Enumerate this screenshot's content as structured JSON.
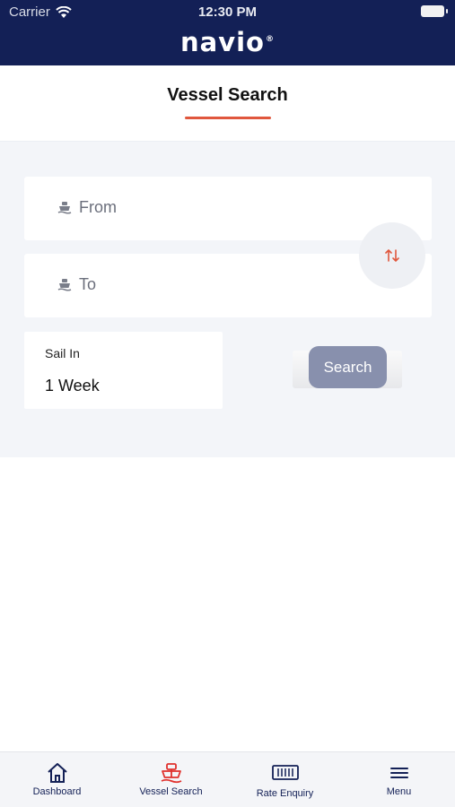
{
  "status_bar": {
    "carrier": "Carrier",
    "time": "12:30 PM"
  },
  "header": {
    "logo": "navio",
    "logo_mark": "®"
  },
  "page": {
    "title": "Vessel Search"
  },
  "search": {
    "from_placeholder": "From",
    "to_placeholder": "To",
    "sail_in_label": "Sail In",
    "sail_in_value": "1 Week",
    "search_label": "Search"
  },
  "tabs": [
    {
      "label": "Dashboard",
      "icon": "home-icon"
    },
    {
      "label": "Vessel Search",
      "icon": "ship-icon"
    },
    {
      "label": "Rate Enquiry",
      "icon": "container-icon"
    },
    {
      "label": "Menu",
      "icon": "hamburger-icon"
    }
  ],
  "colors": {
    "header_bg": "#132056",
    "accent": "#e0573d",
    "search_button": "#8890ad",
    "panel_bg": "#f3f5f9"
  }
}
